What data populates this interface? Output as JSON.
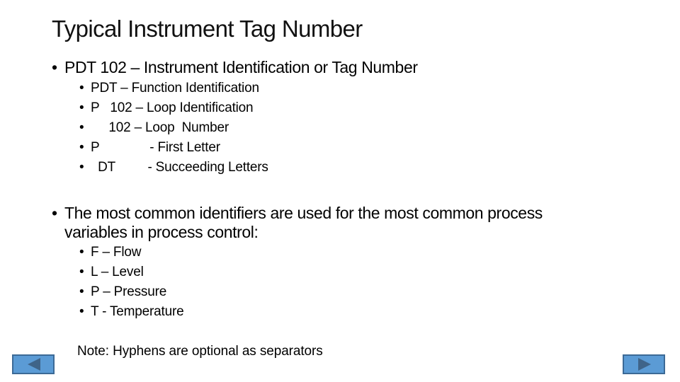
{
  "slide": {
    "title": "Typical Instrument Tag Number",
    "bullet_glyph": "•",
    "section1": {
      "heading": "PDT 102 – Instrument Identification or Tag Number",
      "items": [
        "PDT – Function Identification",
        "P   102 – Loop Identification",
        "     102 – Loop  Number",
        "P              - First Letter",
        "  DT         - Succeeding Letters"
      ]
    },
    "section2": {
      "heading_line1": "The most common identifiers are used for the most common process",
      "heading_line2": "variables in process control:",
      "items": [
        "F – Flow",
        "L – Level",
        "P – Pressure",
        "T - Temperature"
      ]
    },
    "note": "Note: Hyphens are optional as separators"
  },
  "navigation": {
    "prev_icon": "triangle-left-icon",
    "next_icon": "triangle-right-icon",
    "button_color": "#5b9bd5",
    "border_color": "#3c6a96",
    "arrow_color": "#3f6489"
  }
}
